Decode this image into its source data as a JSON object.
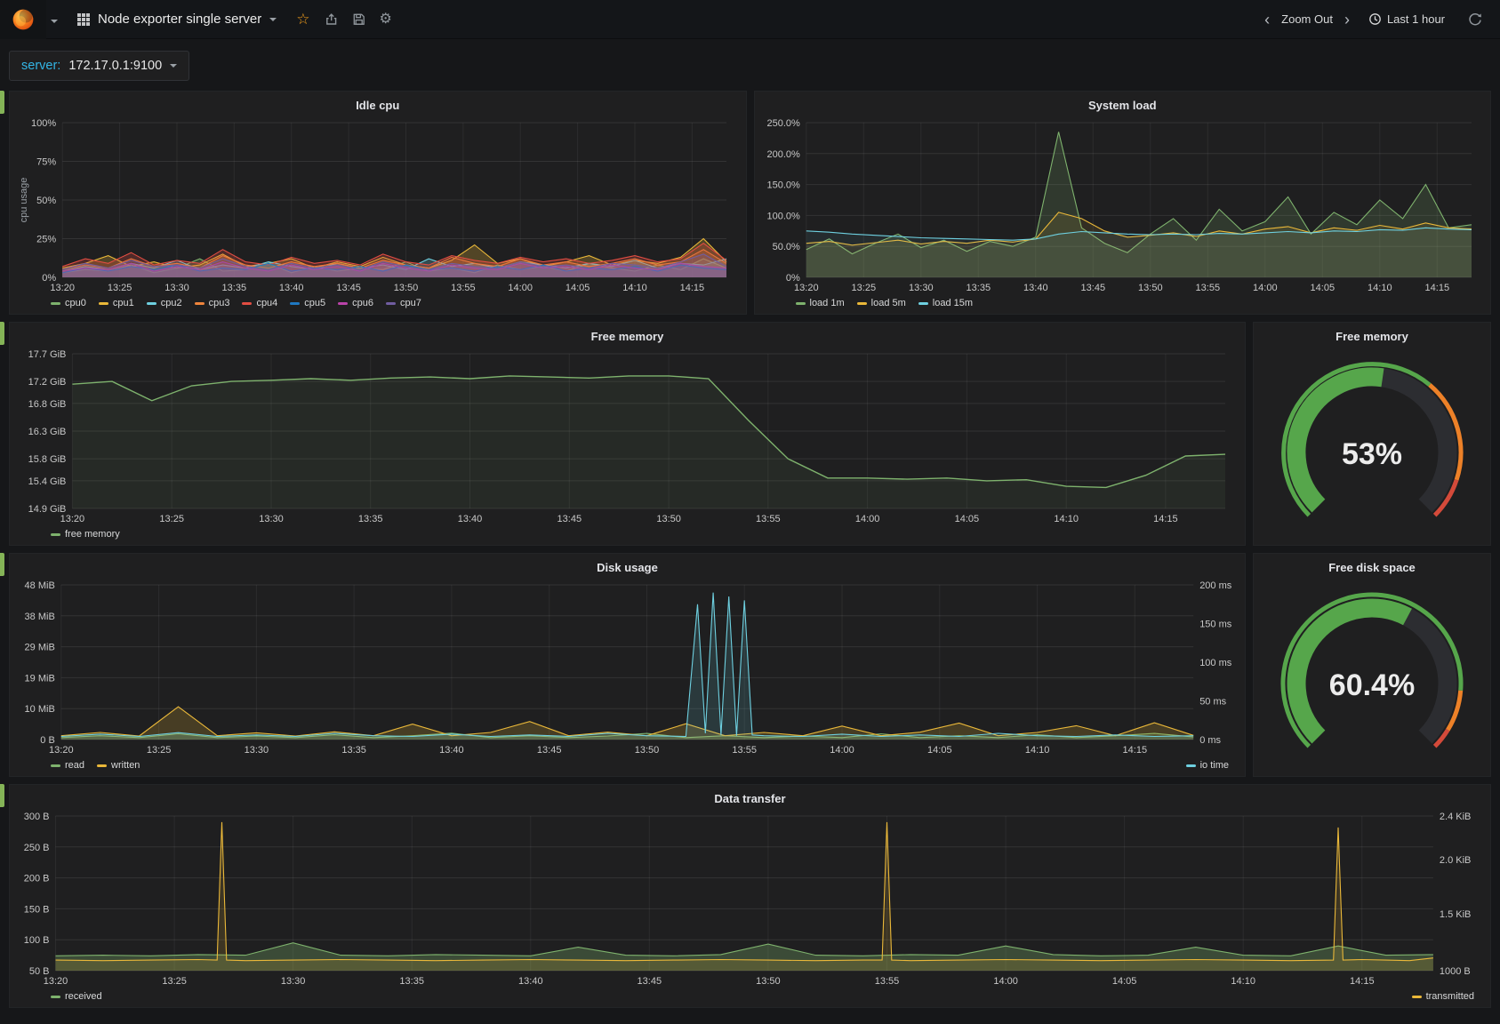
{
  "navbar": {
    "dashboard_title": "Node exporter single server",
    "zoom_out_label": "Zoom Out",
    "time_range_label": "Last 1 hour"
  },
  "icons": {
    "chevron_left": "‹",
    "chevron_right": "›",
    "star": "☆",
    "gear": "⚙"
  },
  "submenu": {
    "server_label": "server:",
    "server_value": "172.17.0.1:9100"
  },
  "colors": {
    "page_bg": "#161719",
    "panel_bg": "#1f1f20",
    "row_tab_green": "#84b457",
    "palette": [
      "#7EB26D",
      "#EAB839",
      "#6ED0E0",
      "#EF843C",
      "#E24D42",
      "#1F78C1",
      "#BA43A9",
      "#705DA0"
    ]
  },
  "time_axis": {
    "tick_minutes": [
      0,
      5,
      10,
      15,
      20,
      25,
      30,
      35,
      40,
      45,
      50,
      55
    ],
    "tick_labels": [
      "13:20",
      "13:25",
      "13:30",
      "13:35",
      "13:40",
      "13:45",
      "13:50",
      "13:55",
      "14:00",
      "14:05",
      "14:10",
      "14:15"
    ]
  },
  "chart_data": [
    {
      "id": "idle_cpu",
      "type": "line",
      "title": "Idle cpu",
      "ylabel": "cpu usage",
      "ylim": [
        0,
        100
      ],
      "xlim": [
        0,
        58
      ],
      "x_start": 0,
      "x_step": 2,
      "yticks": [
        {
          "v": 0,
          "label": "0%"
        },
        {
          "v": 25,
          "label": "25%"
        },
        {
          "v": 50,
          "label": "50%"
        },
        {
          "v": 75,
          "label": "75%"
        },
        {
          "v": 100,
          "label": "100%"
        }
      ],
      "series": [
        {
          "name": "cpu0",
          "color": "#7EB26D",
          "fill": 0.25,
          "legend": "left",
          "values": [
            3,
            5,
            4,
            8,
            3,
            6,
            12,
            4,
            5,
            9,
            3,
            7,
            4,
            6,
            5,
            10,
            4,
            6,
            3,
            8,
            5,
            7,
            4,
            9,
            6,
            4,
            8,
            5,
            12,
            6
          ]
        },
        {
          "name": "cpu1",
          "color": "#EAB839",
          "fill": 0.25,
          "legend": "left",
          "values": [
            6,
            9,
            14,
            7,
            10,
            6,
            8,
            15,
            7,
            9,
            12,
            6,
            10,
            7,
            13,
            8,
            6,
            11,
            21,
            9,
            12,
            7,
            10,
            14,
            8,
            11,
            9,
            13,
            25,
            10
          ]
        },
        {
          "name": "cpu2",
          "color": "#6ED0E0",
          "fill": 0.25,
          "legend": "left",
          "values": [
            4,
            7,
            5,
            9,
            6,
            11,
            5,
            8,
            6,
            10,
            7,
            5,
            9,
            6,
            8,
            5,
            12,
            7,
            9,
            6,
            10,
            8,
            6,
            9,
            7,
            11,
            6,
            9,
            8,
            12
          ]
        },
        {
          "name": "cpu3",
          "color": "#EF843C",
          "fill": 0.25,
          "legend": "left",
          "values": [
            5,
            8,
            6,
            12,
            7,
            9,
            6,
            14,
            8,
            6,
            10,
            7,
            9,
            6,
            11,
            8,
            6,
            13,
            9,
            7,
            12,
            8,
            10,
            7,
            9,
            12,
            8,
            10,
            18,
            9
          ]
        },
        {
          "name": "cpu4",
          "color": "#E24D42",
          "fill": 0.25,
          "legend": "left",
          "values": [
            7,
            12,
            9,
            16,
            8,
            11,
            9,
            18,
            10,
            8,
            13,
            9,
            11,
            8,
            15,
            10,
            8,
            14,
            11,
            9,
            13,
            10,
            12,
            9,
            11,
            14,
            10,
            12,
            22,
            11
          ]
        },
        {
          "name": "cpu5",
          "color": "#1F78C1",
          "fill": 0.25,
          "legend": "left",
          "values": [
            3,
            6,
            4,
            7,
            5,
            8,
            4,
            6,
            5,
            9,
            4,
            6,
            5,
            7,
            4,
            8,
            5,
            6,
            4,
            7,
            5,
            8,
            4,
            6,
            5,
            7,
            4,
            8,
            6,
            5
          ]
        },
        {
          "name": "cpu6",
          "color": "#BA43A9",
          "fill": 0.25,
          "legend": "left",
          "values": [
            4,
            6,
            5,
            9,
            4,
            7,
            5,
            10,
            6,
            4,
            8,
            5,
            7,
            4,
            9,
            6,
            4,
            8,
            6,
            5,
            9,
            6,
            7,
            5,
            8,
            6,
            5,
            9,
            7,
            6
          ]
        },
        {
          "name": "cpu7",
          "color": "#705DA0",
          "fill": 0.25,
          "legend": "left",
          "values": [
            5,
            9,
            6,
            11,
            7,
            8,
            6,
            12,
            7,
            5,
            9,
            6,
            8,
            5,
            10,
            7,
            5,
            9,
            7,
            6,
            10,
            7,
            8,
            6,
            9,
            8,
            6,
            10,
            15,
            7
          ]
        }
      ]
    },
    {
      "id": "system_load",
      "type": "line",
      "title": "System load",
      "ylim": [
        0,
        250
      ],
      "xlim": [
        0,
        58
      ],
      "x_start": 0,
      "x_step": 2,
      "yticks": [
        {
          "v": 0,
          "label": "0%"
        },
        {
          "v": 50,
          "label": "50.0%"
        },
        {
          "v": 100,
          "label": "100.0%"
        },
        {
          "v": 150,
          "label": "150.0%"
        },
        {
          "v": 200,
          "label": "200.0%"
        },
        {
          "v": 250,
          "label": "250.0%"
        }
      ],
      "series": [
        {
          "name": "load 1m",
          "color": "#7EB26D",
          "fill": 0.18,
          "legend": "left",
          "values": [
            45,
            62,
            38,
            55,
            70,
            48,
            60,
            42,
            58,
            50,
            65,
            235,
            80,
            55,
            40,
            70,
            95,
            60,
            110,
            75,
            90,
            130,
            70,
            105,
            85,
            125,
            95,
            150,
            80,
            85
          ]
        },
        {
          "name": "load 5m",
          "color": "#EAB839",
          "fill": 0.1,
          "legend": "left",
          "values": [
            55,
            58,
            52,
            56,
            60,
            54,
            58,
            55,
            60,
            57,
            62,
            105,
            95,
            75,
            65,
            68,
            72,
            66,
            75,
            70,
            78,
            82,
            72,
            80,
            76,
            84,
            78,
            88,
            80,
            78
          ]
        },
        {
          "name": "load 15m",
          "color": "#6ED0E0",
          "fill": 0.08,
          "legend": "left",
          "values": [
            75,
            73,
            70,
            68,
            66,
            64,
            63,
            62,
            61,
            60,
            62,
            70,
            74,
            72,
            70,
            69,
            70,
            69,
            71,
            70,
            72,
            74,
            72,
            75,
            74,
            77,
            76,
            80,
            78,
            77
          ]
        }
      ]
    },
    {
      "id": "free_memory",
      "type": "line",
      "title": "Free memory",
      "ylim": [
        14.9,
        17.7
      ],
      "xlim": [
        0,
        58
      ],
      "x_start": 0,
      "x_step": 2,
      "yticks": [
        {
          "v": 14.9,
          "label": "14.9 GiB"
        },
        {
          "v": 15.4,
          "label": "15.4 GiB"
        },
        {
          "v": 15.8,
          "label": "15.8 GiB"
        },
        {
          "v": 16.3,
          "label": "16.3 GiB"
        },
        {
          "v": 16.8,
          "label": "16.8 GiB"
        },
        {
          "v": 17.2,
          "label": "17.2 GiB"
        },
        {
          "v": 17.7,
          "label": "17.7 GiB"
        }
      ],
      "series": [
        {
          "name": "free memory",
          "color": "#7EB26D",
          "fill": 0.08,
          "width": 1.4,
          "legend": "left",
          "values": [
            17.15,
            17.2,
            16.85,
            17.12,
            17.2,
            17.22,
            17.25,
            17.22,
            17.26,
            17.28,
            17.25,
            17.3,
            17.28,
            17.26,
            17.3,
            17.3,
            17.25,
            16.5,
            15.8,
            15.45,
            15.45,
            15.43,
            15.45,
            15.4,
            15.42,
            15.3,
            15.28,
            15.5,
            15.85,
            15.88
          ]
        }
      ]
    },
    {
      "id": "disk_usage",
      "type": "line",
      "title": "Disk usage",
      "ylim": [
        0,
        48
      ],
      "xlim": [
        0,
        58
      ],
      "x_start": 0,
      "x_step": 2,
      "yticks": [
        {
          "v": 0,
          "label": "0 B"
        },
        {
          "v": 9.6,
          "label": "10 MiB"
        },
        {
          "v": 19.2,
          "label": "19 MiB"
        },
        {
          "v": 28.8,
          "label": "29 MiB"
        },
        {
          "v": 38.4,
          "label": "38 MiB"
        },
        {
          "v": 48,
          "label": "48 MiB"
        }
      ],
      "right_ylim": [
        0,
        200
      ],
      "right_yticks": [
        {
          "v": 0,
          "label": "0 ms"
        },
        {
          "v": 50,
          "label": "50 ms"
        },
        {
          "v": 100,
          "label": "100 ms"
        },
        {
          "v": 150,
          "label": "150 ms"
        },
        {
          "v": 200,
          "label": "200 ms"
        }
      ],
      "series": [
        {
          "name": "read",
          "color": "#7EB26D",
          "fill": 0.2,
          "legend": "left",
          "values": [
            0.6,
            1.2,
            0.6,
            1.8,
            0.6,
            1.1,
            0.6,
            1.5,
            0.6,
            1.2,
            2.0,
            0.6,
            1.2,
            0.6,
            1.1,
            1.9,
            0.6,
            1.2,
            0.6,
            1.1,
            0.6,
            1.8,
            0.6,
            1.2,
            0.6,
            1.5,
            0.6,
            1.2,
            1.9,
            0.8
          ]
        },
        {
          "name": "written",
          "color": "#EAB839",
          "fill": 0.2,
          "legend": "left",
          "values": [
            1.2,
            2.2,
            1.1,
            10.2,
            1.2,
            2.1,
            1.1,
            2.4,
            1.2,
            4.8,
            1.2,
            2.2,
            5.6,
            1.2,
            2.3,
            1.2,
            4.9,
            1.2,
            2.2,
            1.2,
            4.2,
            1.2,
            2.3,
            5.1,
            1.2,
            2.2,
            4.3,
            1.2,
            5.2,
            1.3
          ]
        },
        {
          "name": "io time",
          "color": "#6ED0E0",
          "fill": 0.15,
          "axis": "right",
          "legend": "right",
          "x": [
            0,
            2,
            4,
            6,
            8,
            10,
            12,
            14,
            16,
            18,
            20,
            22,
            24,
            26,
            28,
            30,
            32,
            32.6,
            33,
            33.4,
            33.8,
            34.2,
            34.6,
            35,
            35.4,
            36,
            38,
            40,
            42,
            44,
            46,
            48,
            50,
            52,
            54,
            56,
            58
          ],
          "values": [
            4,
            7,
            4,
            9,
            4,
            6,
            4,
            8,
            5,
            4,
            7,
            4,
            6,
            4,
            8,
            5,
            4,
            175,
            8,
            190,
            6,
            185,
            5,
            180,
            6,
            5,
            4,
            7,
            4,
            6,
            4,
            8,
            5,
            4,
            6,
            4,
            5
          ]
        }
      ]
    },
    {
      "id": "data_transfer",
      "type": "line",
      "title": "Data transfer",
      "ylim": [
        50,
        300
      ],
      "xlim": [
        0,
        58
      ],
      "x_start": 0,
      "x_step": 2,
      "yticks": [
        {
          "v": 50,
          "label": "50 B"
        },
        {
          "v": 100,
          "label": "100 B"
        },
        {
          "v": 150,
          "label": "150 B"
        },
        {
          "v": 200,
          "label": "200 B"
        },
        {
          "v": 250,
          "label": "250 B"
        },
        {
          "v": 300,
          "label": "300 B"
        }
      ],
      "right_ylim": [
        1000,
        2458
      ],
      "right_yticks": [
        {
          "v": 1000,
          "label": "1000 B"
        },
        {
          "v": 1536,
          "label": "1.5 KiB"
        },
        {
          "v": 2048,
          "label": "2.0 KiB"
        },
        {
          "v": 2458,
          "label": "2.4 KiB"
        }
      ],
      "series": [
        {
          "name": "received",
          "color": "#7EB26D",
          "fill": 0.3,
          "legend": "left",
          "values": [
            74,
            75,
            74,
            76,
            75,
            95,
            75,
            74,
            76,
            75,
            74,
            88,
            75,
            74,
            76,
            93,
            75,
            74,
            76,
            75,
            90,
            76,
            74,
            75,
            88,
            75,
            74,
            90,
            75,
            76
          ]
        },
        {
          "name": "transmitted",
          "color": "#EAB839",
          "fill": 0.15,
          "axis": "right",
          "legend": "right",
          "x": [
            0,
            2,
            4,
            6,
            6.8,
            7,
            7.2,
            8,
            10,
            12,
            14,
            16,
            18,
            20,
            22,
            24,
            26,
            28,
            30,
            32,
            34,
            34.8,
            35,
            35.2,
            36,
            38,
            40,
            42,
            44,
            46,
            48,
            50,
            52,
            53.8,
            54,
            54.2,
            55,
            56,
            57,
            58
          ],
          "values": [
            1100,
            1095,
            1100,
            1105,
            1100,
            2400,
            1100,
            1095,
            1100,
            1105,
            1100,
            1095,
            1100,
            1105,
            1100,
            1095,
            1100,
            1105,
            1100,
            1095,
            1100,
            1100,
            2400,
            1100,
            1095,
            1100,
            1105,
            1100,
            1095,
            1100,
            1105,
            1100,
            1095,
            1100,
            2350,
            1100,
            1105,
            1100,
            1095,
            1120
          ]
        }
      ]
    }
  ],
  "gauges": [
    {
      "id": "free_memory_gauge",
      "title": "Free memory",
      "value": 53,
      "display": "53%",
      "thresholds": [
        0.65,
        0.9
      ],
      "colors": {
        "value": "#56a64b",
        "orange": "#ed8128",
        "red": "#d44a3a",
        "track": "#2c2d31"
      }
    },
    {
      "id": "free_disk_gauge",
      "title": "Free disk space",
      "value": 60.4,
      "display": "60.4%",
      "thresholds": [
        0.85,
        0.95
      ],
      "colors": {
        "value": "#56a64b",
        "orange": "#ed8128",
        "red": "#d44a3a",
        "track": "#2c2d31"
      }
    }
  ]
}
